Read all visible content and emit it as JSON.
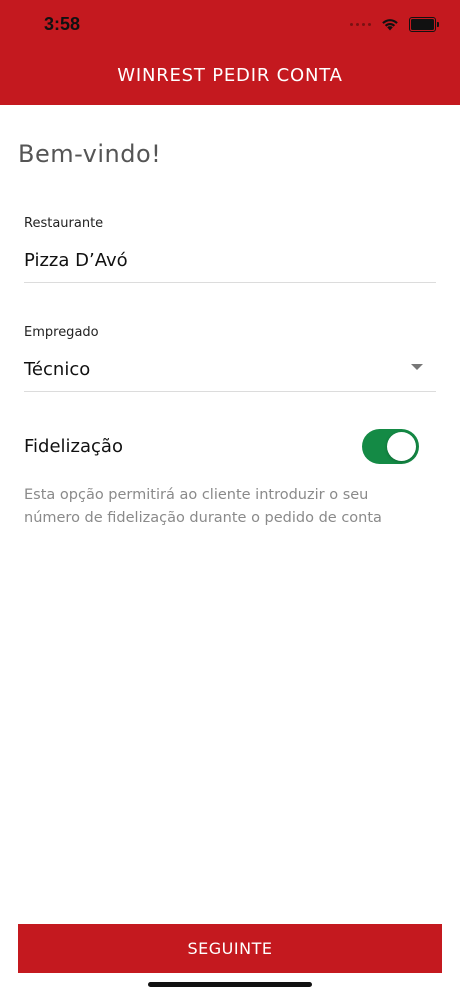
{
  "status_bar": {
    "time": "3:58"
  },
  "header": {
    "title": "WINREST PEDIR CONTA",
    "background_color": "#c4191f"
  },
  "welcome": "Bem-vindo!",
  "restaurant_field": {
    "label": "Restaurante",
    "value": "Pizza D’Avó"
  },
  "employee_field": {
    "label": "Empregado",
    "value": "Técnico",
    "icon": "chevron-down-icon"
  },
  "loyalty": {
    "label": "Fidelização",
    "enabled": true,
    "toggle_color": "#148a45",
    "description": "Esta opção permitirá ao cliente introduzir o seu número de fidelização durante o pedido de conta"
  },
  "next_button": {
    "label": "SEGUINTE",
    "color": "#c4191f"
  }
}
